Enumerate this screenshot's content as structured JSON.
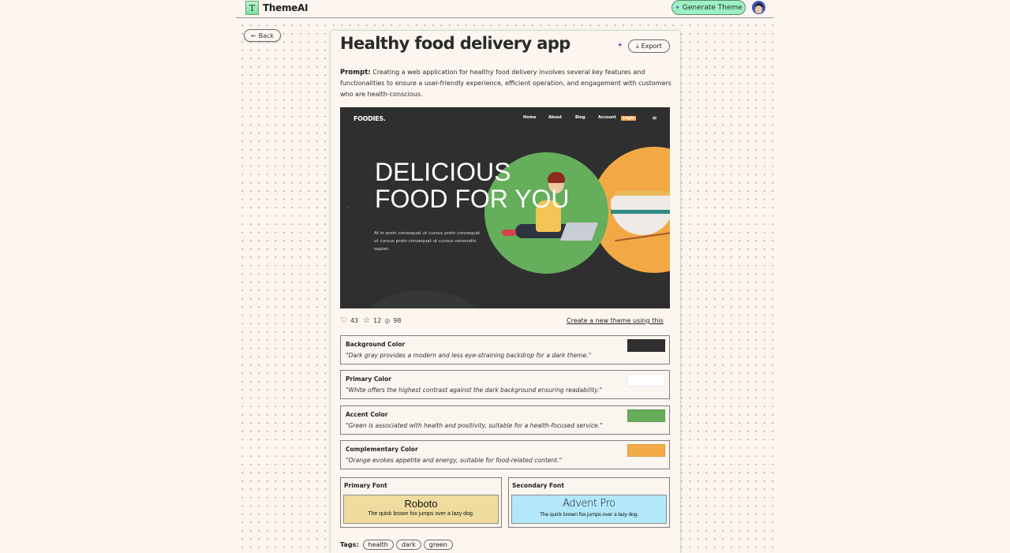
{
  "app": {
    "name": "ThemeAI",
    "logo_glyph": "T",
    "generate_button": "Generate Theme",
    "wand_icon": "✨"
  },
  "nav": {
    "back_label": "Back"
  },
  "theme": {
    "title": "Healthy food delivery app",
    "export_label": "Export",
    "prompt_label": "Prompt:",
    "prompt_text": "Creating a web application for healthy food delivery involves several key features and functionalities to ensure a user-friendly experience, efficient operation, and engagement with customers who are health-conscious."
  },
  "preview": {
    "logo": "FOODIES.",
    "nav_items": [
      "Home",
      "About",
      "Blog",
      "Account"
    ],
    "login": "Login",
    "headline_line1": "DELICIOUS",
    "headline_line2": "FOOD FOR YOU",
    "subtext": "At in proin consequat ut cursus proin consequat ut cursus proin consequat ut cursus venenatis sapien.",
    "prev_arrow": "‹",
    "menu_icon": "≡"
  },
  "stats": {
    "likes": "43",
    "stars": "12",
    "views": "98",
    "create_link": "Create a new theme using this"
  },
  "colors": [
    {
      "label": "Background Color",
      "description": "\"Dark gray provides a modern and less eye-straining backdrop for a dark theme.\"",
      "hex": "#2f2f2f"
    },
    {
      "label": "Primary Color",
      "description": "\"White offers the highest contrast against the dark background ensuring readability.\"",
      "hex": "#ffffff"
    },
    {
      "label": "Accent Color",
      "description": "\"Green is associated with health and positivity, suitable for a health-focused service.\"",
      "hex": "#66ad5a"
    },
    {
      "label": "Complementary Color",
      "description": "\"Orange evokes appetite and energy, suitable for food-related content.\"",
      "hex": "#f3aa47"
    }
  ],
  "fonts": [
    {
      "label": "Primary Font",
      "name": "Roboto",
      "sample": "The quick brown fox jumps over a lazy dog.",
      "bg": "#f1dc9f"
    },
    {
      "label": "Secondary Font",
      "name": "Advent Pro",
      "sample": "The quick brown fox jumps over a lazy dog.",
      "bg": "#b3e8fb"
    }
  ],
  "tags": {
    "label": "Tags:",
    "items": [
      "health",
      "dark",
      "green"
    ]
  }
}
